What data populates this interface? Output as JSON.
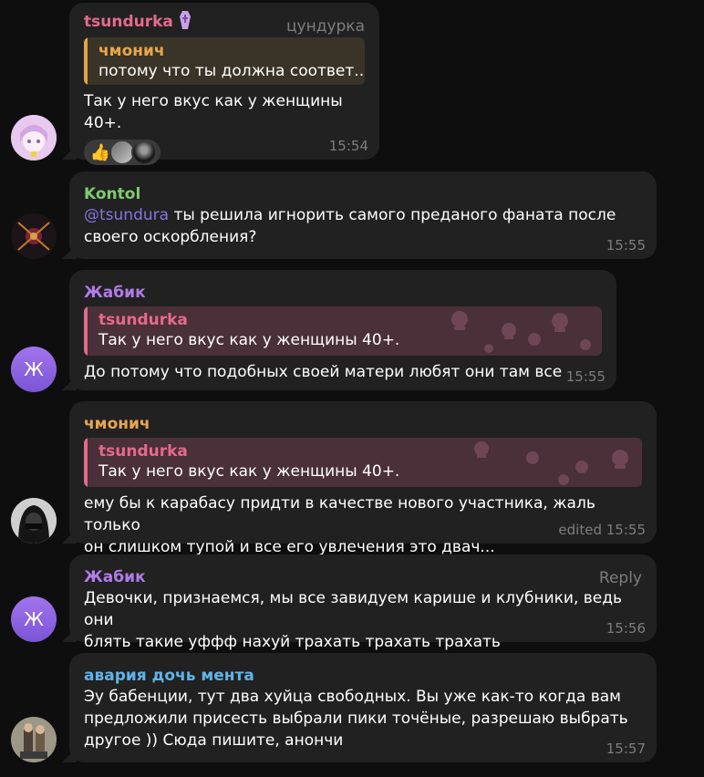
{
  "messages": [
    {
      "sender": "tsundurka",
      "sender_badge_icon": "coffin-icon",
      "alias": "цундурка",
      "quote_name": "чмонич",
      "quote_text": "потому что ты должна соответ...",
      "text": "Так у него вкус как у женщины 40+.",
      "reaction_emoji": "👍",
      "time": "15:54"
    },
    {
      "sender": "Kontol",
      "mention": "@tsundura",
      "text_line1": " ты решила игнорить самого преданого фаната после",
      "text_line2": "своего оскорбления?",
      "time": "15:55"
    },
    {
      "sender": "Жабик",
      "avatar_letter": "Ж",
      "quote_name": "tsundurka",
      "quote_text": "Так у него вкус как у женщины 40+.",
      "text": "До потому что подобных своей матери любят они там все",
      "time": "15:55"
    },
    {
      "sender": "чмонич",
      "quote_name": "tsundurka",
      "quote_text": "Так у него вкус как у женщины 40+.",
      "text_line1": "ему бы к карабасу придти в качестве нового участника, жаль только",
      "text_line2": "он слишком тупой и все его увлечения это двач...",
      "edited": "edited",
      "time": "15:55"
    },
    {
      "sender": "Жабик",
      "avatar_letter": "Ж",
      "reply_label": "Reply",
      "text_line1": "Девочки, признаемся, мы все завидуем карише и клубники, ведь они",
      "text_line2": "блять такие уффф нахуй трахать трахать трахать",
      "time": "15:56"
    },
    {
      "sender": "авария дочь мента",
      "text_line1": "Эу бабенции, тут два хуйца свободных. Вы уже как-то когда вам",
      "text_line2": "предложили присесть выбрали пики точёные, разрешаю выбрать",
      "text_line3": "другое )) Сюда пишите, анончи",
      "time": "15:57"
    }
  ],
  "colors": {
    "bubble": "#212121",
    "background": "#0e0e0e",
    "name_pink": "#e56a8d",
    "name_green": "#7ecb6f",
    "name_purple": "#b07ce8",
    "name_orange": "#e8a64d",
    "name_blue": "#5fb4e8",
    "mention": "#8774e1",
    "meta_gray": "#7d7d7d"
  }
}
